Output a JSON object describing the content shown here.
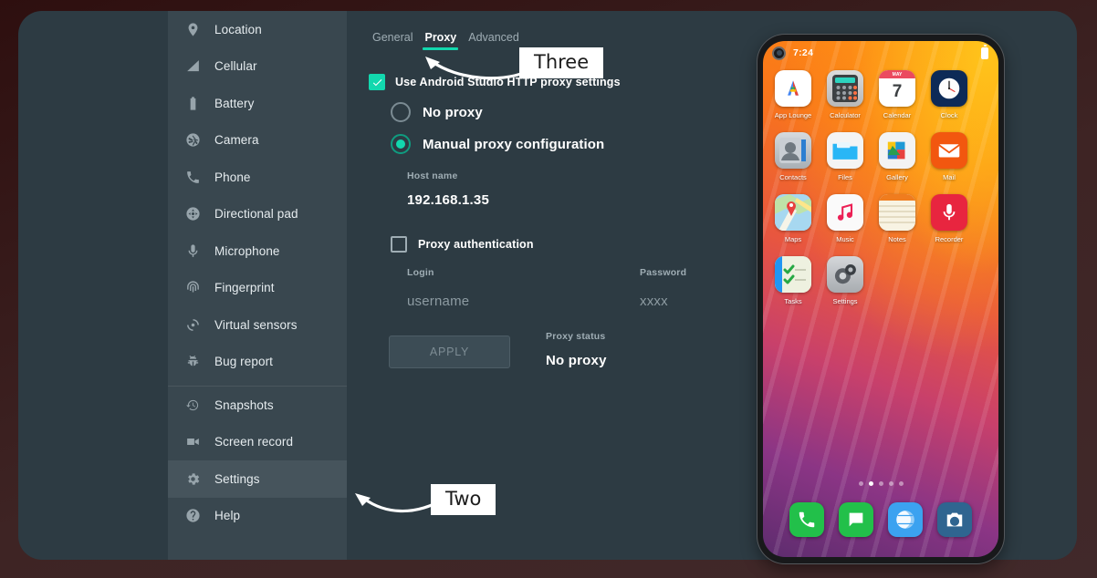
{
  "window": {
    "background_color": "#2d3b43",
    "outer_color": "#3e2424"
  },
  "sidebar": {
    "background_color": "#39474f",
    "selected_color": "#46545c",
    "groups": [
      {
        "items": [
          {
            "label": "Location",
            "icon": "location-pin-icon"
          },
          {
            "label": "Cellular",
            "icon": "signal-bars-icon"
          },
          {
            "label": "Battery",
            "icon": "battery-icon"
          },
          {
            "label": "Camera",
            "icon": "camera-aperture-icon"
          },
          {
            "label": "Phone",
            "icon": "phone-handset-icon"
          },
          {
            "label": "Directional pad",
            "icon": "dpad-icon"
          },
          {
            "label": "Microphone",
            "icon": "microphone-icon"
          },
          {
            "label": "Fingerprint",
            "icon": "fingerprint-icon"
          },
          {
            "label": "Virtual sensors",
            "icon": "virtual-sensors-icon"
          },
          {
            "label": "Bug report",
            "icon": "bug-icon"
          }
        ]
      },
      {
        "items": [
          {
            "label": "Snapshots",
            "icon": "history-clock-icon"
          },
          {
            "label": "Screen record",
            "icon": "video-camera-icon"
          },
          {
            "label": "Settings",
            "icon": "gear-icon",
            "selected": true
          },
          {
            "label": "Help",
            "icon": "question-circle-icon"
          }
        ]
      }
    ]
  },
  "content": {
    "tabs": [
      {
        "label": "General",
        "active": false
      },
      {
        "label": "Proxy",
        "active": true
      },
      {
        "label": "Advanced",
        "active": false
      }
    ],
    "accent_color": "#12d8ae",
    "use_proxy_checkbox": {
      "label": "Use Android Studio HTTP proxy settings",
      "checked": true
    },
    "radios": [
      {
        "label": "No proxy",
        "selected": false
      },
      {
        "label": "Manual proxy configuration",
        "selected": true
      }
    ],
    "host_name": {
      "label": "Host name",
      "value": "192.168.1.35"
    },
    "proxy_auth_checkbox": {
      "label": "Proxy authentication",
      "checked": false
    },
    "login": {
      "label": "Login",
      "value": "username"
    },
    "password": {
      "label": "Password",
      "value": "xxxx"
    },
    "apply_button": {
      "label": "APPLY"
    },
    "proxy_status": {
      "label": "Proxy status",
      "value": "No proxy"
    }
  },
  "callouts": [
    {
      "label": "Three",
      "target": "proxy-tab"
    },
    {
      "label": "Two",
      "target": "settings-sidebar-item"
    }
  ],
  "phone": {
    "status_bar": {
      "time": "7:24",
      "battery_icon": "battery-full-icon",
      "camera_icon": "punch-hole-camera-icon"
    },
    "app_rows": [
      [
        {
          "name": "App Lounge",
          "icon": "app-lounge-icon"
        },
        {
          "name": "Calculator",
          "icon": "calculator-icon"
        },
        {
          "name": "Calendar",
          "icon": "calendar-icon",
          "day": "7",
          "month": "MAY"
        },
        {
          "name": "Clock",
          "icon": "clock-icon"
        }
      ],
      [
        {
          "name": "Contacts",
          "icon": "contacts-icon"
        },
        {
          "name": "Files",
          "icon": "files-folder-icon"
        },
        {
          "name": "Gallery",
          "icon": "gallery-icon"
        },
        {
          "name": "Mail",
          "icon": "mail-envelope-icon"
        }
      ],
      [
        {
          "name": "Maps",
          "icon": "maps-icon"
        },
        {
          "name": "Music",
          "icon": "music-note-icon"
        },
        {
          "name": "Notes",
          "icon": "notes-icon"
        },
        {
          "name": "Recorder",
          "icon": "recorder-microphone-icon"
        }
      ],
      [
        {
          "name": "Tasks",
          "icon": "tasks-checklist-icon"
        },
        {
          "name": "Settings",
          "icon": "settings-gears-icon"
        }
      ]
    ],
    "page_dots": {
      "count": 5,
      "active_index": 1
    },
    "dock": [
      {
        "name": "Phone",
        "icon": "dock-phone-icon"
      },
      {
        "name": "Messages",
        "icon": "dock-messages-icon"
      },
      {
        "name": "Browser",
        "icon": "dock-browser-icon"
      },
      {
        "name": "Camera",
        "icon": "dock-camera-icon"
      }
    ]
  }
}
